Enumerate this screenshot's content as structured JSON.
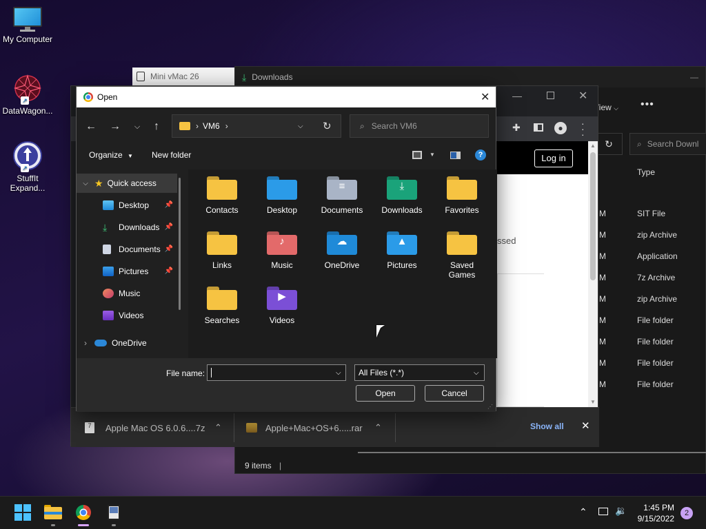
{
  "desktop": {
    "icons": [
      {
        "label": "My Computer"
      },
      {
        "label": "DataWagon..."
      },
      {
        "label": "StuffIt Expand..."
      }
    ]
  },
  "background_windows": {
    "minivmac_title": "Mini vMac 26",
    "downloads_title": "Downloads",
    "explorer": {
      "view_label": "View",
      "search_placeholder": "Search Downl",
      "type_header": "Type",
      "rows": [
        {
          "time": "M",
          "type": "SIT File"
        },
        {
          "time": "M",
          "type": "zip Archive"
        },
        {
          "time": "M",
          "type": "Application"
        },
        {
          "time": "M",
          "type": "7z Archive"
        },
        {
          "time": "M",
          "type": "zip Archive"
        },
        {
          "time": "M",
          "type": "File folder"
        },
        {
          "time": "M",
          "type": "File folder"
        },
        {
          "time": "M",
          "type": "File folder"
        },
        {
          "time": "M",
          "type": "File folder"
        }
      ],
      "status": "9 items"
    },
    "chrome": {
      "login_label": "Log in",
      "partial_text": "ssed",
      "downloads": [
        {
          "name": "Apple Mac OS 6.0.6....7z"
        },
        {
          "name": "Apple+Mac+OS+6.....rar"
        }
      ],
      "show_all": "Show all"
    }
  },
  "dialog": {
    "title": "Open",
    "address": {
      "folder": "VM6"
    },
    "search_placeholder": "Search VM6",
    "toolbar": {
      "organize": "Organize",
      "new_folder": "New folder"
    },
    "nav": {
      "quick_access": "Quick access",
      "items": [
        {
          "label": "Desktop"
        },
        {
          "label": "Downloads"
        },
        {
          "label": "Documents"
        },
        {
          "label": "Pictures"
        },
        {
          "label": "Music"
        },
        {
          "label": "Videos"
        }
      ],
      "onedrive": "OneDrive"
    },
    "files": [
      {
        "label": "Contacts"
      },
      {
        "label": "Desktop"
      },
      {
        "label": "Documents"
      },
      {
        "label": "Downloads"
      },
      {
        "label": "Favorites"
      },
      {
        "label": "Links"
      },
      {
        "label": "Music"
      },
      {
        "label": "OneDrive"
      },
      {
        "label": "Pictures"
      },
      {
        "label": "Saved Games"
      },
      {
        "label": "Searches"
      },
      {
        "label": "Videos"
      }
    ],
    "file_name_label": "File name:",
    "file_name_value": "",
    "file_type": "All Files (*.*)",
    "open_label": "Open",
    "cancel_label": "Cancel"
  },
  "taskbar": {
    "time": "1:45 PM",
    "date": "9/15/2022",
    "notification_count": "2"
  }
}
